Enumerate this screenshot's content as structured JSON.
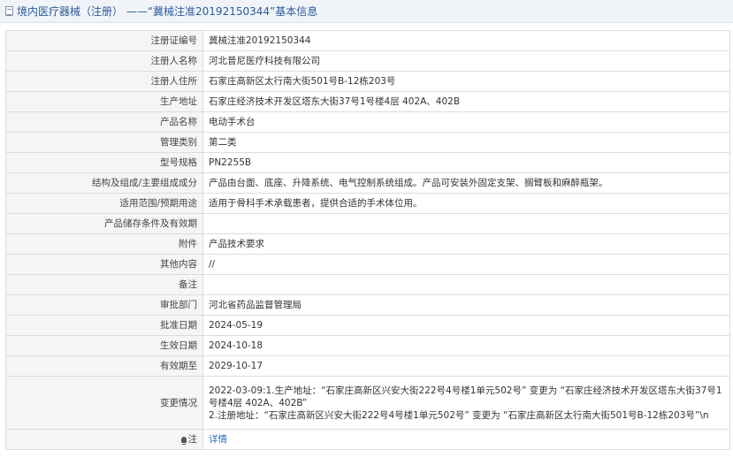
{
  "header": {
    "breadcrumb": "境内医疗器械（注册） ——“冀械注准20192150344”基本信息"
  },
  "fields": [
    {
      "label": "注册证编号",
      "value": "冀械注准20192150344"
    },
    {
      "label": "注册人名称",
      "value": "河北普尼医疗科技有限公司"
    },
    {
      "label": "注册人住所",
      "value": "石家庄高新区太行南大街501号B-12栋203号"
    },
    {
      "label": "生产地址",
      "value": "石家庄经济技术开发区塔东大街37号1号楼4层 402A、402B"
    },
    {
      "label": "产品名称",
      "value": "电动手术台"
    },
    {
      "label": "管理类别",
      "value": "第二类"
    },
    {
      "label": "型号规格",
      "value": "PN2255B"
    },
    {
      "label": "结构及组成/主要组成成分",
      "value": "产品由台面、底座、升降系统、电气控制系统组成。产品可安装外固定支架、搁臂板和麻醉瓶架。"
    },
    {
      "label": "适用范围/预期用途",
      "value": "适用于骨科手术承载患者，提供合适的手术体位用。"
    },
    {
      "label": "产品储存条件及有效期",
      "value": ""
    },
    {
      "label": "附件",
      "value": "产品技术要求"
    },
    {
      "label": "其他内容",
      "value": "//"
    },
    {
      "label": "备注",
      "value": ""
    },
    {
      "label": "审批部门",
      "value": "河北省药品监督管理局"
    },
    {
      "label": "批准日期",
      "value": "2024-05-19"
    },
    {
      "label": "生效日期",
      "value": "2024-10-18"
    },
    {
      "label": "有效期至",
      "value": "2029-10-17"
    }
  ],
  "changes": {
    "label": "变更情况",
    "lines": [
      "2022-03-09:1.生产地址：“石家庄高新区兴安大街222号4号楼1单元502号” 变更为 “石家庄经济技术开发区塔东大街37号1号楼4层 402A、402B”",
      "2.注册地址：“石家庄高新区兴安大街222号4号楼1单元502号” 变更为 “石家庄高新区太行南大街501号B-12栋203号”\\n"
    ]
  },
  "note": {
    "label": "注",
    "icon": "lamp-icon",
    "link": "详情"
  }
}
